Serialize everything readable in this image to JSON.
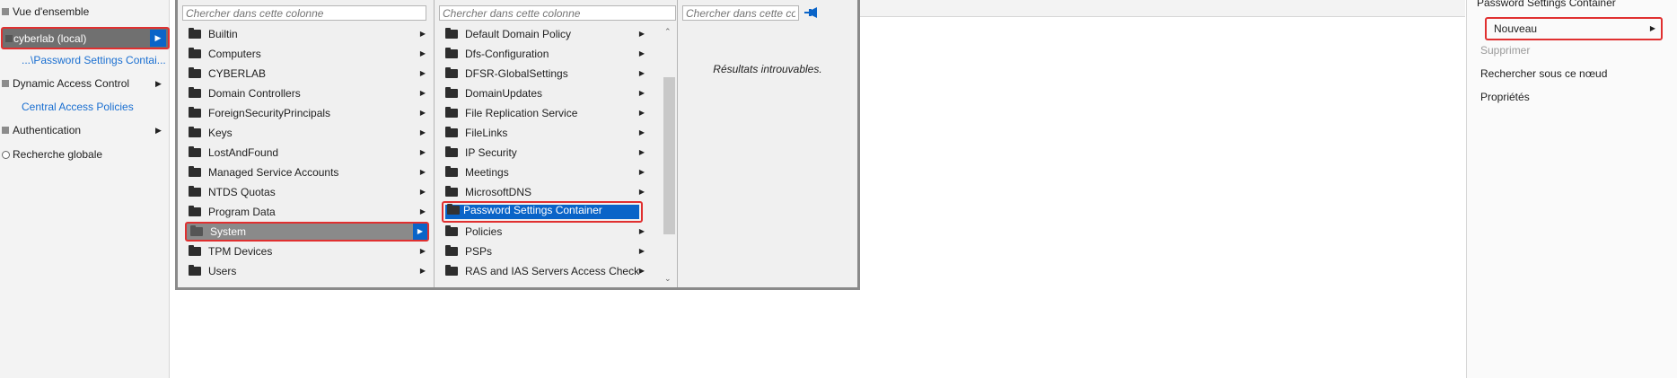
{
  "nav": {
    "overview": "Vue d'ensemble",
    "domain": "cyberlab (local)",
    "breadcrumb_link": "...\\Password Settings Contai...",
    "dynamic_access_control": "Dynamic Access Control",
    "central_access_policies": "Central Access Policies",
    "authentication": "Authentication",
    "global_search": "Recherche globale"
  },
  "columns": {
    "placeholder": "Chercher dans cette colonne",
    "col1_items": [
      "Builtin",
      "Computers",
      "CYBERLAB",
      "Domain Controllers",
      "ForeignSecurityPrincipals",
      "Keys",
      "LostAndFound",
      "Managed Service Accounts",
      "NTDS Quotas",
      "Program Data",
      "System",
      "TPM Devices",
      "Users"
    ],
    "col1_selected": "System",
    "col2_items": [
      "Default Domain Policy",
      "Dfs-Configuration",
      "DFSR-GlobalSettings",
      "DomainUpdates",
      "File Replication Service",
      "FileLinks",
      "IP Security",
      "Meetings",
      "MicrosoftDNS",
      "Password Settings Container",
      "Policies",
      "PSPs",
      "RAS and IAS Servers Access Check"
    ],
    "col2_selected": "Password Settings Container",
    "col3_empty": "Résultats introuvables."
  },
  "tasks": {
    "title": "Password Settings Container",
    "new": "Nouveau",
    "delete": "Supprimer",
    "search_under": "Rechercher sous ce nœud",
    "properties": "Propriétés"
  },
  "colors": {
    "accent": "#0a64c8",
    "highlight_border": "#e03030",
    "link": "#1a6fd1"
  }
}
